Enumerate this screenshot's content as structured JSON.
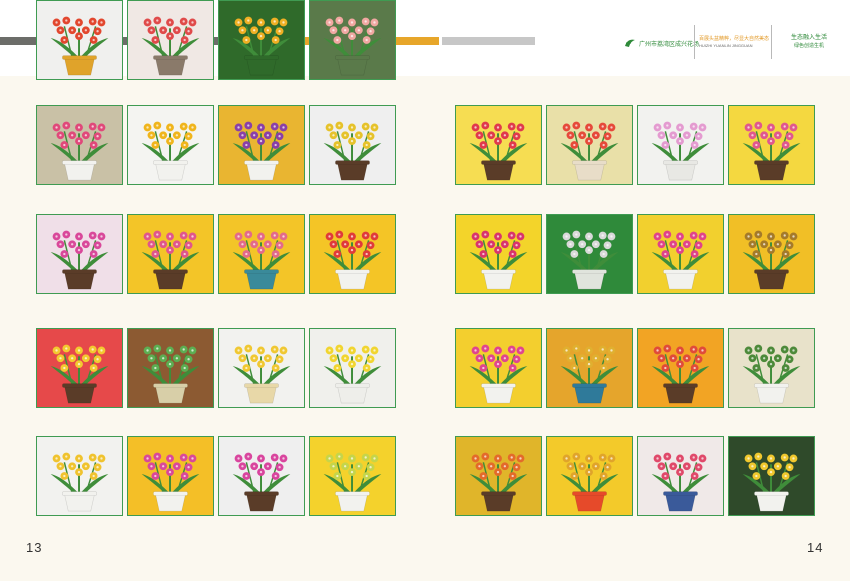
{
  "header": {
    "bar_colors": [
      "#6c6d69",
      "#e7a62a",
      "#c7c7c7"
    ],
    "brand_name": "广州市荔湾区成兴花场",
    "slogan_cn": "百展头盆精粹，尽显大自然美态",
    "slogan_en": "HUIZHI YUANLIN JINGGUAN",
    "motto_line1": "生态融入生活",
    "motto_line2": "绿色创造生机"
  },
  "pages": {
    "left_number": "13",
    "right_number": "14"
  },
  "photos": [
    {
      "bg": "#c9c1a6",
      "flower": "#e0487a",
      "pot": "#f2f2ee",
      "leaf": "#3f8d3a"
    },
    {
      "bg": "#f4f4f1",
      "flower": "#f0b51c",
      "pot": "#f2f2ee",
      "leaf": "#3f8d3a"
    },
    {
      "bg": "#e9b531",
      "flower": "#8a3fa8",
      "pot": "#f2f2ee",
      "leaf": "#3f8d3a"
    },
    {
      "bg": "#efefef",
      "flower": "#e6c22a",
      "pot": "#5a3c28",
      "leaf": "#3f8d3a"
    },
    {
      "bg": "#f6dd52",
      "flower": "#e0394c",
      "pot": "#5a3c28",
      "leaf": "#3f8d3a"
    },
    {
      "bg": "#e9e0a8",
      "flower": "#e6493a",
      "pot": "#e8ddc8",
      "leaf": "#3f8d3a"
    },
    {
      "bg": "#f2f2ef",
      "flower": "#e49bd0",
      "pot": "#e8e8e4",
      "leaf": "#3f8d3a"
    },
    {
      "bg": "#f4d840",
      "flower": "#e0578e",
      "pot": "#5a3c28",
      "leaf": "#3f8d3a"
    },
    {
      "bg": "#f0dfe8",
      "flower": "#d9489a",
      "pot": "#5a3c28",
      "leaf": "#3f8d3a"
    },
    {
      "bg": "#f3c528",
      "flower": "#e0568c",
      "pot": "#5a3c28",
      "leaf": "#3f8d3a"
    },
    {
      "bg": "#f3c528",
      "flower": "#e36a8a",
      "pot": "#3a8a9a",
      "leaf": "#3f8d3a"
    },
    {
      "bg": "#f4c526",
      "flower": "#e03a3a",
      "pot": "#f2f2ee",
      "leaf": "#3f8d3a"
    },
    {
      "bg": "#f3d42a",
      "flower": "#d9346c",
      "pot": "#f2f2ee",
      "leaf": "#3f8d3a"
    },
    {
      "bg": "#2f8a3a",
      "flower": "#d9d9d9",
      "pot": "#e0e4dc",
      "leaf": "#3f8d3a"
    },
    {
      "bg": "#f2d02e",
      "flower": "#e0438a",
      "pot": "#f2f2ee",
      "leaf": "#3f8d3a"
    },
    {
      "bg": "#f1bf26",
      "flower": "#a47a2a",
      "pot": "#5a3c28",
      "leaf": "#3f8d3a"
    },
    {
      "bg": "#e6494a",
      "flower": "#f3c930",
      "pot": "#5a3c28",
      "leaf": "#3f8d3a"
    },
    {
      "bg": "#8c5a32",
      "flower": "#5cae52",
      "pot": "#d8cfa8",
      "leaf": "#3f8d3a"
    },
    {
      "bg": "#f2f2ef",
      "flower": "#f0c832",
      "pot": "#e8d8a8",
      "leaf": "#3f8d3a"
    },
    {
      "bg": "#f0f0ec",
      "flower": "#f1d530",
      "pot": "#eeeeea",
      "leaf": "#3f8d3a"
    },
    {
      "bg": "#f3cf2e",
      "flower": "#e0458f",
      "pot": "#f2f2ee",
      "leaf": "#3f8d3a"
    },
    {
      "bg": "#e5a52c",
      "flower": "#e0b030",
      "pot": "#2f7a9a",
      "leaf": "#3f8d3a"
    },
    {
      "bg": "#f2a424",
      "flower": "#e04a3a",
      "pot": "#5a3c28",
      "leaf": "#3f8d3a"
    },
    {
      "bg": "#e8e2ca",
      "flower": "#4d8a3a",
      "pot": "#f2f2ee",
      "leaf": "#3f8d3a"
    },
    {
      "bg": "#f2f2ef",
      "flower": "#f0c32e",
      "pot": "#f2f2ee",
      "leaf": "#3f8d3a"
    },
    {
      "bg": "#f4bf27",
      "flower": "#d9489a",
      "pot": "#f2f2ee",
      "leaf": "#3f8d3a"
    },
    {
      "bg": "#efefef",
      "flower": "#d9459e",
      "pot": "#5a3c28",
      "leaf": "#3f8d3a"
    },
    {
      "bg": "#f4d22c",
      "flower": "#c5d54a",
      "pot": "#f2f2ee",
      "leaf": "#3f8d3a"
    },
    {
      "bg": "#e0b52a",
      "flower": "#e36a2a",
      "pot": "#5a3c28",
      "leaf": "#3f8d3a"
    },
    {
      "bg": "#f3ca2a",
      "flower": "#e0a42a",
      "pot": "#e64a2a",
      "leaf": "#3f8d3a"
    },
    {
      "bg": "#f0e9e8",
      "flower": "#e0496a",
      "pot": "#3a5a9a",
      "leaf": "#3f8d3a"
    },
    {
      "bg": "#2f4a2a",
      "flower": "#f0c82e",
      "pot": "#f2f2ee",
      "leaf": "#3f8d3a"
    },
    {
      "bg": "#f0f0ee",
      "flower": "#e2472e",
      "pot": "#e0a32a",
      "leaf": "#3f8d3a"
    },
    {
      "bg": "#f0e8e4",
      "flower": "#e04a4a",
      "pot": "#8a7a6a",
      "leaf": "#3f8d3a"
    },
    {
      "bg": "#2f6a2a",
      "flower": "#f0b024",
      "pot": "#2f6a2a",
      "leaf": "#3f8d3a"
    },
    {
      "bg": "#5a7a4a",
      "flower": "#f1a8a2",
      "pot": "#5a7a4a",
      "leaf": "#3f8d3a"
    }
  ]
}
